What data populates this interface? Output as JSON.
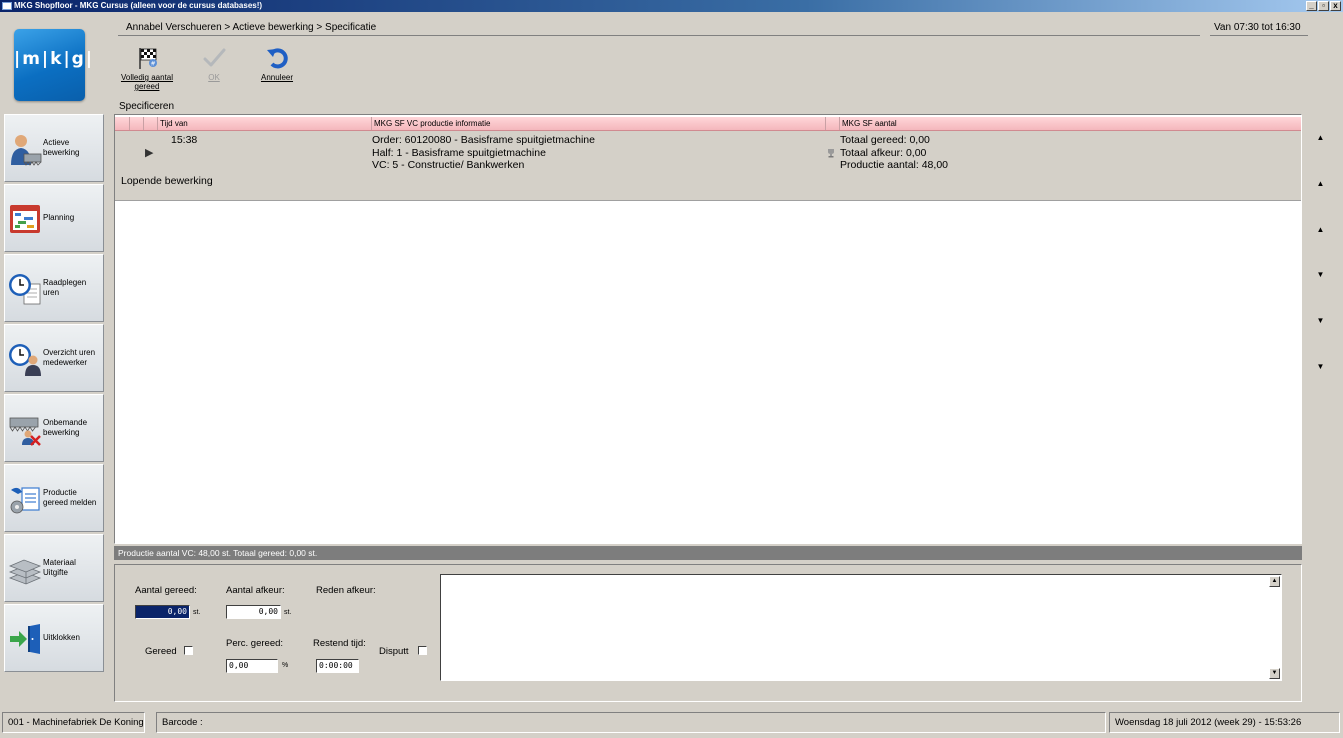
{
  "window": {
    "title": "MKG Shopfloor - MKG Cursus (alleen voor de cursus databases!)",
    "controls": [
      "_",
      "ā",
      "x"
    ]
  },
  "logo": {
    "text": "|m|k|g|"
  },
  "breadcrumb": "Annabel Verschueren > Actieve bewerking > Specificatie",
  "time_range": "Van 07:30 tot 16:30",
  "toolbar": {
    "complete_label": "Volledig aantal gereed",
    "ok_label": "OK",
    "cancel_label": "Annuleer"
  },
  "section_label": "Specificeren",
  "sidebar": {
    "items": [
      {
        "label": "Actieve bewerking",
        "icon": "worker-icon"
      },
      {
        "label": "Planning",
        "icon": "planning-icon"
      },
      {
        "label": "Raadplegen uren",
        "icon": "clock-document-icon"
      },
      {
        "label": "Overzicht uren medewerker",
        "icon": "clock-person-icon"
      },
      {
        "label": "Onbemande bewerking",
        "icon": "unmanned-icon"
      },
      {
        "label": "Productie gereed melden",
        "icon": "production-report-icon"
      },
      {
        "label": "Materiaal Uitgifte",
        "icon": "material-icon"
      },
      {
        "label": "Uitklokken",
        "icon": "exit-door-icon"
      }
    ]
  },
  "grid": {
    "columns": [
      "Tijd van",
      "MKG SF VC productie informatie",
      "MKG SF aantal"
    ],
    "row": {
      "time": "15:38",
      "order": "Order: 60120080 - Basisframe spuitgietmachine",
      "half": "Half: 1 - Basisframe spuitgietmachine",
      "vc": "VC: 5 - Constructie/ Bankwerken",
      "total_done": "Totaal gereed: 0,00",
      "total_reject": "Totaal afkeur: 0,00",
      "production_qty": "Productie aantal: 48,00",
      "group_label": "Lopende bewerking"
    }
  },
  "status_strip": "Productie aantal VC: 48,00 st.   Totaal gereed: 0,00 st.",
  "form": {
    "qty_done_label": "Aantal gereed:",
    "qty_done_value": "0,00",
    "qty_done_unit": "st.",
    "qty_reject_label": "Aantal afkeur:",
    "qty_reject_value": "0,00",
    "qty_reject_unit": "st.",
    "reason_label": "Reden afkeur:",
    "done_label": "Gereed",
    "perc_label": "Perc. gereed:",
    "perc_value": "0,00",
    "perc_unit": "%",
    "remaining_label": "Restend tijd:",
    "remaining_value": "0:00:00",
    "dispute_label": "Disputt"
  },
  "statusbar": {
    "company": "001 - Machinefabriek De Koning",
    "barcode_label": "Barcode :",
    "datetime": "Woensdag 18 juli 2012 (week 29) - 15:53:26"
  },
  "colors": {
    "titlebar": "#0a246a",
    "grid_header": "#f4b7bc",
    "logo": "#0b6fc2",
    "form_bg": "#d4d0c8"
  }
}
